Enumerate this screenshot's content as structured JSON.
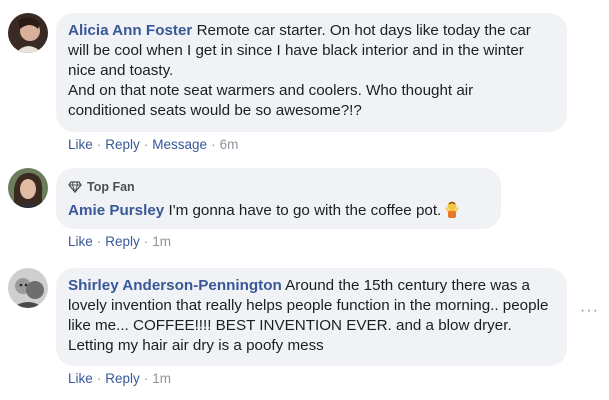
{
  "comments": [
    {
      "author": "Alicia Ann Foster",
      "text_line1": " Remote car starter. On hot days like today the car will be cool when I get in since I have black interior and in the winter nice and toasty.",
      "text_line2": "And on that note seat warmers and coolers. Who thought air conditioned seats would be so awesome?!?",
      "actions": {
        "like": "Like",
        "reply": "Reply",
        "message": "Message",
        "time": "6m"
      }
    },
    {
      "badge": "Top Fan",
      "author": "Amie Pursley",
      "text": " I'm gonna have to go with the coffee pot.",
      "emoji": "person-shrugging-emoji",
      "actions": {
        "like": "Like",
        "reply": "Reply",
        "time": "1m"
      }
    },
    {
      "author": "Shirley Anderson-Pennington",
      "text": " Around the 15th century there was a lovely invention that really helps people function in the morning.. people like me... COFFEE!!!! BEST INVENTION EVER. and a blow dryer. Letting my hair air dry is a poofy mess",
      "actions": {
        "like": "Like",
        "reply": "Reply",
        "time": "1m"
      }
    }
  ],
  "separator": "·",
  "more_options": "···",
  "colors": {
    "link": "#385898",
    "bubble": "#f0f2f5",
    "meta": "#90949c",
    "text": "#1c1e21"
  }
}
